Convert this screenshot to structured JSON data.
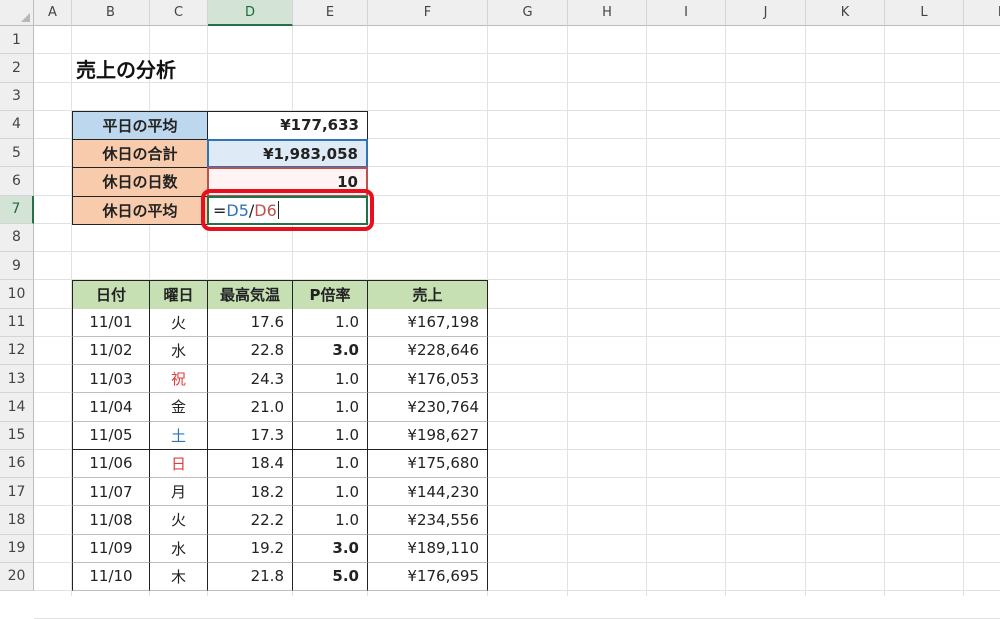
{
  "columns": [
    "A",
    "B",
    "C",
    "D",
    "E",
    "F",
    "G",
    "H",
    "I",
    "J",
    "K",
    "L",
    "M"
  ],
  "rows": [
    "1",
    "2",
    "3",
    "4",
    "5",
    "6",
    "7",
    "8",
    "9",
    "10",
    "11",
    "12",
    "13",
    "14",
    "15",
    "16",
    "17",
    "18",
    "19",
    "20"
  ],
  "title": "売上の分析",
  "summary": [
    {
      "label": "平日の平均",
      "value": "¥177,633",
      "tone": "blue"
    },
    {
      "label": "休日の合計",
      "value": "¥1,983,058",
      "tone": "orange"
    },
    {
      "label": "休日の日数",
      "value": "10",
      "tone": "orange"
    },
    {
      "label": "休日の平均",
      "value": "",
      "tone": "orange"
    }
  ],
  "formula": {
    "eq": "=",
    "ref1": "D5",
    "op": "/",
    "ref2": "D6"
  },
  "colors": {
    "ref1": "#2e75b6",
    "ref2": "#c0504d",
    "holiday": "#e03c3c",
    "saturday": "#2e75b6",
    "highlight": "#e8101e",
    "accent": "#217346"
  },
  "table": {
    "headers": [
      "日付",
      "曜日",
      "最高気温",
      "P倍率",
      "売上"
    ],
    "rows": [
      {
        "date": "11/01",
        "day": "火",
        "dayColor": "",
        "temp": "17.6",
        "rate": "1.0",
        "rateBold": false,
        "sales": "¥167,198"
      },
      {
        "date": "11/02",
        "day": "水",
        "dayColor": "",
        "temp": "22.8",
        "rate": "3.0",
        "rateBold": true,
        "sales": "¥228,646"
      },
      {
        "date": "11/03",
        "day": "祝",
        "dayColor": "holiday",
        "temp": "24.3",
        "rate": "1.0",
        "rateBold": false,
        "sales": "¥176,053"
      },
      {
        "date": "11/04",
        "day": "金",
        "dayColor": "",
        "temp": "21.0",
        "rate": "1.0",
        "rateBold": false,
        "sales": "¥230,764"
      },
      {
        "date": "11/05",
        "day": "土",
        "dayColor": "saturday",
        "temp": "17.3",
        "rate": "1.0",
        "rateBold": false,
        "sales": "¥198,627"
      },
      {
        "date": "11/06",
        "day": "日",
        "dayColor": "holiday",
        "temp": "18.4",
        "rate": "1.0",
        "rateBold": false,
        "sales": "¥175,680"
      },
      {
        "date": "11/07",
        "day": "月",
        "dayColor": "",
        "temp": "18.2",
        "rate": "1.0",
        "rateBold": false,
        "sales": "¥144,230"
      },
      {
        "date": "11/08",
        "day": "火",
        "dayColor": "",
        "temp": "22.2",
        "rate": "1.0",
        "rateBold": false,
        "sales": "¥234,556"
      },
      {
        "date": "11/09",
        "day": "水",
        "dayColor": "",
        "temp": "19.2",
        "rate": "3.0",
        "rateBold": true,
        "sales": "¥189,110"
      },
      {
        "date": "11/10",
        "day": "木",
        "dayColor": "",
        "temp": "21.8",
        "rate": "5.0",
        "rateBold": true,
        "sales": "¥176,695"
      }
    ]
  }
}
